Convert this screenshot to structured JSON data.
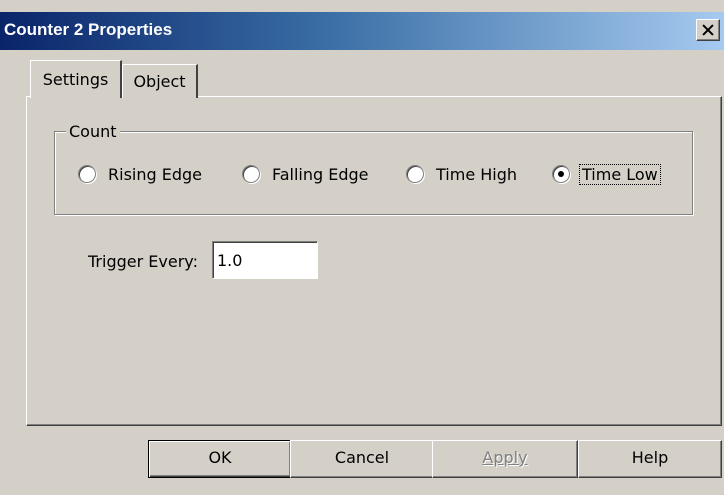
{
  "window": {
    "title": "Counter 2 Properties"
  },
  "tabs": [
    {
      "label": "Settings",
      "selected": true
    },
    {
      "label": "Object",
      "selected": false
    }
  ],
  "count_group": {
    "label": "Count",
    "options": [
      {
        "label": "Rising Edge",
        "selected": false
      },
      {
        "label": "Falling Edge",
        "selected": false
      },
      {
        "label": "Time High",
        "selected": false
      },
      {
        "label": "Time Low",
        "selected": true
      }
    ]
  },
  "trigger": {
    "label": "Trigger Every:",
    "value": "1.0"
  },
  "buttons": {
    "ok": "OK",
    "cancel": "Cancel",
    "apply": "Apply",
    "help": "Help"
  },
  "colors": {
    "dialog_bg": "#d4d0c8",
    "title_start": "#0a246a",
    "title_end": "#a6caf0"
  }
}
